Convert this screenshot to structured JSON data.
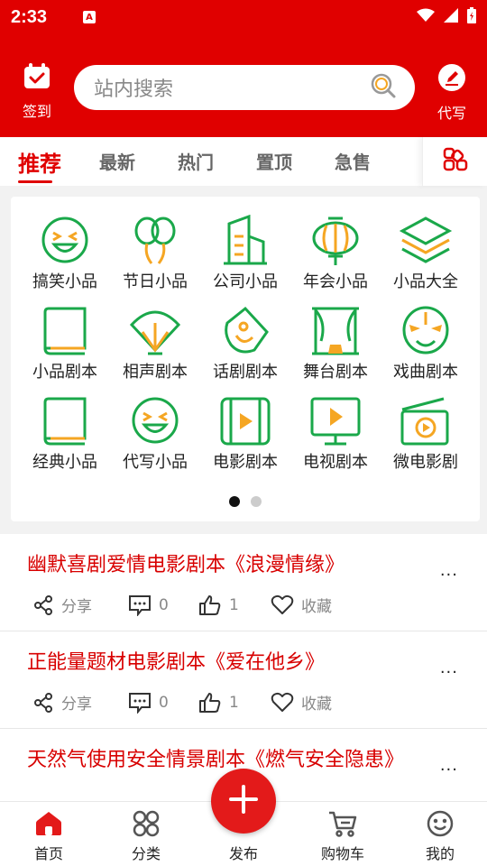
{
  "status_bar": {
    "time": "2:33",
    "notif_icon_letter": "A"
  },
  "header": {
    "checkin_label": "签到",
    "search_placeholder": "站内搜索",
    "write_label": "代写"
  },
  "tabs": [
    {
      "label": "推荐",
      "active": true
    },
    {
      "label": "最新",
      "active": false
    },
    {
      "label": "热门",
      "active": false
    },
    {
      "label": "置顶",
      "active": false
    },
    {
      "label": "急售",
      "active": false
    }
  ],
  "categories": [
    {
      "label": "搞笑小品",
      "icon": "laughing-face-icon"
    },
    {
      "label": "节日小品",
      "icon": "balloons-icon"
    },
    {
      "label": "公司小品",
      "icon": "building-icon"
    },
    {
      "label": "年会小品",
      "icon": "lantern-icon"
    },
    {
      "label": "小品大全",
      "icon": "layers-icon"
    },
    {
      "label": "小品剧本",
      "icon": "book-icon"
    },
    {
      "label": "相声剧本",
      "icon": "fan-icon"
    },
    {
      "label": "话剧剧本",
      "icon": "mask-icon"
    },
    {
      "label": "舞台剧本",
      "icon": "stage-icon"
    },
    {
      "label": "戏曲剧本",
      "icon": "opera-mask-icon"
    },
    {
      "label": "经典小品",
      "icon": "book-icon"
    },
    {
      "label": "代写小品",
      "icon": "laughing-face-icon"
    },
    {
      "label": "电影剧本",
      "icon": "film-icon"
    },
    {
      "label": "电视剧本",
      "icon": "tv-icon"
    },
    {
      "label": "微电影剧",
      "icon": "clapper-icon"
    }
  ],
  "pager": {
    "pages": 2,
    "current": 1
  },
  "posts": [
    {
      "title": "幽默喜剧爱情电影剧本《浪漫情缘》",
      "more": "...",
      "share": "分享",
      "comments": "0",
      "likes": "1",
      "favorite": "收藏"
    },
    {
      "title": "正能量题材电影剧本《爱在他乡》",
      "more": "...",
      "share": "分享",
      "comments": "0",
      "likes": "1",
      "favorite": "收藏"
    },
    {
      "title": "天然气使用安全情景剧本《燃气安全隐患》",
      "more": "..."
    }
  ],
  "bottom_nav": {
    "home": "首页",
    "category": "分类",
    "publish": "发布",
    "cart": "购物车",
    "mine": "我的"
  },
  "colors": {
    "brand_red": "#e00000",
    "icon_green": "#1aa84a",
    "icon_orange": "#f5a623"
  }
}
